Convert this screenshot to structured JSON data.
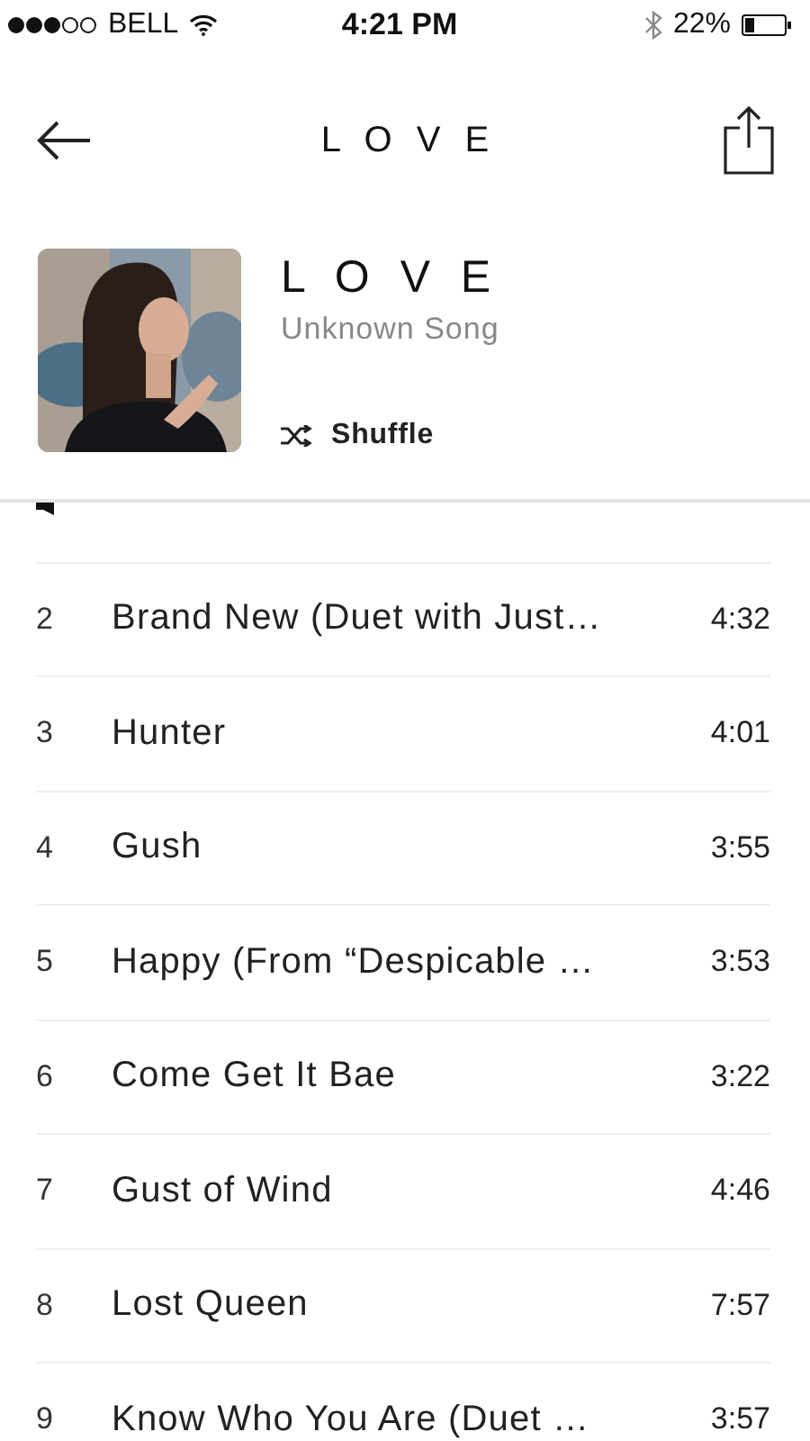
{
  "status_bar": {
    "carrier": "BELL",
    "time": "4:21 PM",
    "battery": "22%"
  },
  "header": {
    "title": "L O V E"
  },
  "album": {
    "title": "L O V E",
    "subtitle": "Unknown Song",
    "shuffle": "Shuffle"
  },
  "tracks": [
    {
      "playing": true
    },
    {
      "playing": false,
      "number": "2",
      "title": "Brand New (Duet with Just…",
      "duration": "4:32"
    },
    {
      "playing": false,
      "number": "3",
      "title": "Hunter",
      "duration": "4:01"
    },
    {
      "playing": false,
      "number": "4",
      "title": "Gush",
      "duration": "3:55"
    },
    {
      "playing": false,
      "number": "5",
      "title": "Happy (From “Despicable …",
      "duration": "3:53"
    },
    {
      "playing": false,
      "number": "6",
      "title": "Come Get It Bae",
      "duration": "3:22"
    },
    {
      "playing": false,
      "number": "7",
      "title": "Gust of Wind",
      "duration": "4:46"
    },
    {
      "playing": false,
      "number": "8",
      "title": "Lost Queen",
      "duration": "7:57"
    },
    {
      "playing": false,
      "number": "9",
      "title": "Know Who You Are (Duet …",
      "duration": "3:57"
    }
  ]
}
